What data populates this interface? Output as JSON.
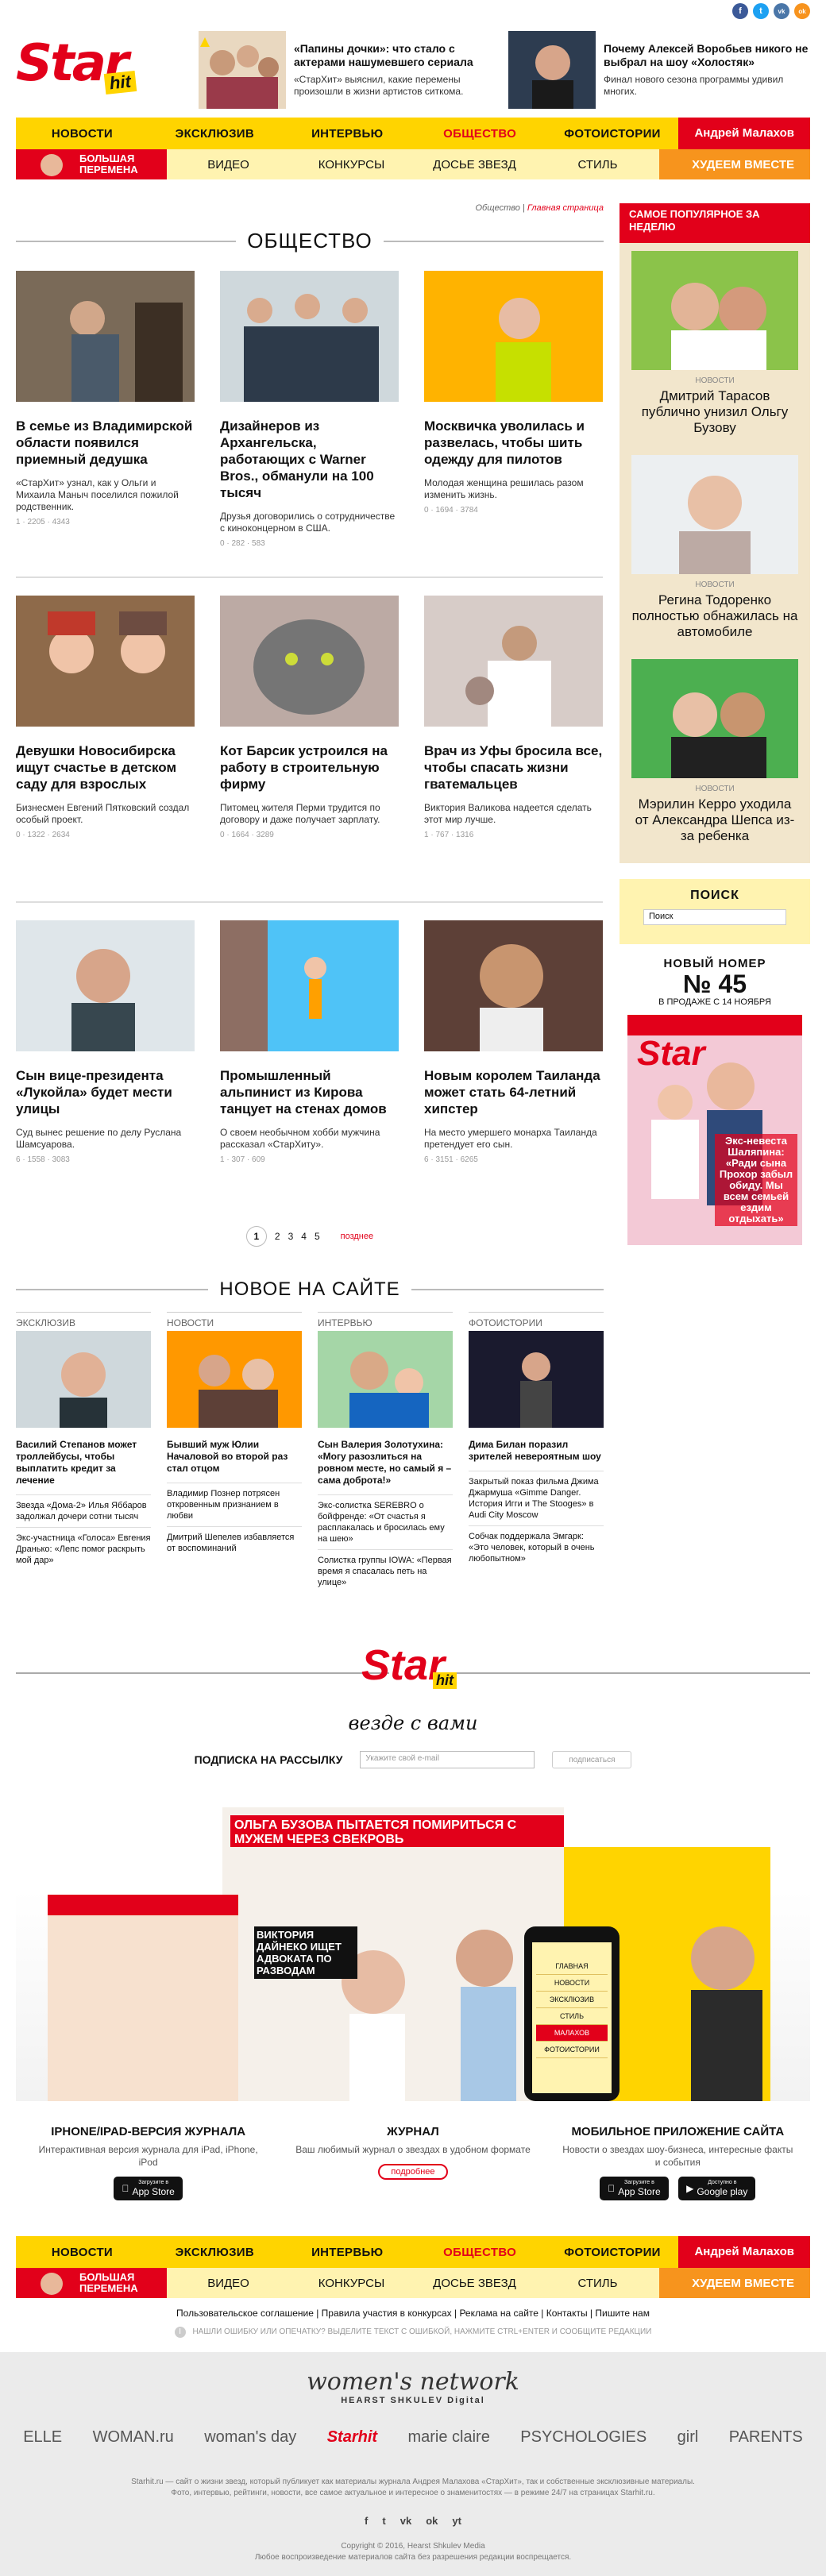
{
  "social_top": [
    "f",
    "t",
    "vk",
    "ok"
  ],
  "header": {
    "logo_star": "Star",
    "logo_hit": "hit",
    "promo1": {
      "title": "«Папины дочки»: что стало с актерами нашумевшего сериала",
      "text": "«СтарХит» выяснил, какие перемены произошли в жизни артистов ситкома."
    },
    "promo2": {
      "title": "Почему Алексей Воробьев никого не выбрал на шоу «Холостяк»",
      "text": "Финал нового сезона программы удивил многих."
    }
  },
  "nav": {
    "items": [
      "Новости",
      "Эксклюзив",
      "Интервью",
      "Общество",
      "Фотоистории"
    ],
    "active": "Общество",
    "special": "Андрей Малахов"
  },
  "nav2": {
    "promo_left": "Большая перемена",
    "items": [
      "Видео",
      "Конкурсы",
      "Досье звезд",
      "Стиль"
    ],
    "promo_right": "Худеем вместе"
  },
  "breadcrumbs": {
    "current": "Общество",
    "sep": "|",
    "home": "Главная страница"
  },
  "section_title": "Общество",
  "articles": [
    {
      "title": "В семье из Владимирской области появился приемный дедушка",
      "desc": "«СтарХит» узнал, как у Ольги и Михаила Маныч поселился пожилой родственник.",
      "meta": "1 · 2205 · 4343"
    },
    {
      "title": "Дизайнеров из Архангельска, работающих с Warner Bros., обманули на 100 тысяч",
      "desc": "Друзья договорились о сотрудничестве с киноконцерном в США.",
      "meta": "0 · 282 · 583"
    },
    {
      "title": "Москвичка уволилась и развелась, чтобы шить одежду для пилотов",
      "desc": "Молодая женщина решилась разом изменить жизнь.",
      "meta": "0 · 1694 · 3784"
    },
    {
      "title": "Девушки Новосибирска ищут счастье в детском саду для взрослых",
      "desc": "Бизнесмен Евгений Пятковский создал особый проект.",
      "meta": "0 · 1322 · 2634"
    },
    {
      "title": "Кот Барсик устроился на работу в строительную фирму",
      "desc": "Питомец жителя Перми трудится по договору и даже получает зарплату.",
      "meta": "0 · 1664 · 3289"
    },
    {
      "title": "Врач из Уфы бросила все, чтобы спасать жизни гватемальцев",
      "desc": "Виктория Валикова надеется сделать этот мир лучше.",
      "meta": "1 · 767 · 1316"
    },
    {
      "title": "Сын вице-президента «Лукойла» будет мести улицы",
      "desc": "Суд вынес решение по делу Руслана Шамсуарова.",
      "meta": "6 · 1558 · 3083"
    },
    {
      "title": "Промышленный альпинист из Кирова танцует на стенах домов",
      "desc": "О своем необычном хобби мужчина рассказал «СтарХиту».",
      "meta": "1 · 307 · 609"
    },
    {
      "title": "Новым королем Таиланда может стать 64-летний хипстер",
      "desc": "На место умершего монарха Таиланда претендует его сын.",
      "meta": "6 · 3151 · 6265"
    }
  ],
  "pager": {
    "pages": [
      "1",
      "2",
      "3",
      "4",
      "5"
    ],
    "next": "позднее"
  },
  "new_on_site": {
    "title": "Новое на сайте",
    "cols": [
      {
        "cat": "Эксклюзив",
        "title": "Василий Степанов может троллейбусы, чтобы выплатить кредит за лечение",
        "subs": [
          "Звезда «Дома-2» Илья Яббаров задолжал дочери сотни тысяч",
          "Экс-участница «Голоса» Евгения Дранько: «Лепс помог раскрыть мой дар»"
        ]
      },
      {
        "cat": "Новости",
        "title": "Бывший муж Юлии Началовой во второй раз стал отцом",
        "subs": [
          "Владимир Познер потрясен откровенным признанием в любви",
          "Дмитрий Шепелев избавляется от воспоминаний"
        ]
      },
      {
        "cat": "Интервью",
        "title": "Сын Валерия Золотухина: «Могу разозлиться на ровном месте, но самый я – сама доброта!»",
        "subs": [
          "Экс-солистка SEREBRO о бойфренде: «От счастья я расплакалась и бросилась ему на шею»",
          "Солистка группы IOWA: «Первая время я спасалась петь на улице»"
        ]
      },
      {
        "cat": "Фотоистории",
        "title": "Дима Билан поразил зрителей невероятным шоу",
        "subs": [
          "Закрытый показ фильма Джима Джармуша «Gimme Danger. История Игги и The Stooges» в Audi City Moscow",
          "Собчак поддержала Эмгарк: «Это человек, который в очень любопытном»"
        ]
      }
    ]
  },
  "sidebar": {
    "popular_title": "Самое популярное за неделю",
    "popular": [
      {
        "cat": "Новости",
        "title": "Дмитрий Тарасов публично унизил Ольгу Бузову"
      },
      {
        "cat": "Новости",
        "title": "Регина Тодоренко полностью обнажилась на автомобиле"
      },
      {
        "cat": "Новости",
        "title": "Мэрилин Керро уходила от Александра Шепса из-за ребенка"
      }
    ],
    "search_label": "Поиск",
    "search_placeholder": "Поиск",
    "issue_title": "Новый номер",
    "issue_number": "№ 45",
    "issue_date": "В продаже с 14 ноября",
    "cover_logo": "Star",
    "cover_text": "Экс-невеста Шаляпина: «Ради сына Прохор забыл обиду. Мы всем семьей ездим отдыхать»"
  },
  "center_logo": {
    "star": "Star",
    "hit": "hit",
    "tagline": "везде с вами"
  },
  "subscribe": {
    "label": "Подписка на рассылку",
    "placeholder": "Укажите свой e-mail",
    "button": "подписаться"
  },
  "hero": {
    "headline": "Ольга Бузова пытается помириться с мужем через свекровь",
    "sub1": "Виктория Дайнеко ищет адвоката по разводам",
    "menu": [
      "Главная",
      "Новости",
      "Эксклюзив",
      "Стиль",
      "Малахов",
      "Фотоистории"
    ]
  },
  "triplet": [
    {
      "title": "iPhone/iPad-версия журнала",
      "text": "Интерактивная версия журнала для iPad, iPhone, iPod",
      "btn": "App Store",
      "btn_small": "Загрузите в"
    },
    {
      "title": "Журнал",
      "text": "Ваш любимый журнал о звездах в удобном формате",
      "btn": "подробнее"
    },
    {
      "title": "Мобильное приложение сайта",
      "text": "Новости о звездах шоу-бизнеса, интересные факты и события",
      "btn": "App Store",
      "btn_small": "Загрузите в",
      "btn2": "Google play",
      "btn2_small": "Доступно в"
    }
  ],
  "footer_links": "Пользовательское соглашение | Правила участия в конкурсах | Реклама на сайте | Контакты | Пишите нам",
  "notice": "Нашли ошибку или опечатку? Выделите текст с ошибкой, нажмите Ctrl+Enter и сообщите редакции",
  "wn": {
    "title": "women's network",
    "sub": "HEARST SHKULEV Digital",
    "brands": [
      "ELLE",
      "WOMAN.ru",
      "woman's day",
      "Starhit",
      "marie claire",
      "PSYCHOLOGIES",
      "girl",
      "PARENTS"
    ],
    "copy1": "Starhit.ru — сайт о жизни звезд, который публикует как материалы журнала Андрея Малахова «СтарХит», так и собственные эксклюзивные материалы.",
    "copy2": "Фото, интервью, рейтинги, новости, все самое актуальное и интересное о знаменитостях — в режиме 24/7 на страницах Starhit.ru.",
    "social": [
      "f",
      "t",
      "vk",
      "ok",
      "yt"
    ],
    "copyright": "Copyright © 2016, Hearst Shkulev Media",
    "reprint": "Любое воспроизведение материалов сайта без разрешения редакции воспрещается."
  },
  "colors": {
    "red": "#e2001a",
    "yellow": "#ffd400",
    "beige": "#f2e6cc"
  }
}
